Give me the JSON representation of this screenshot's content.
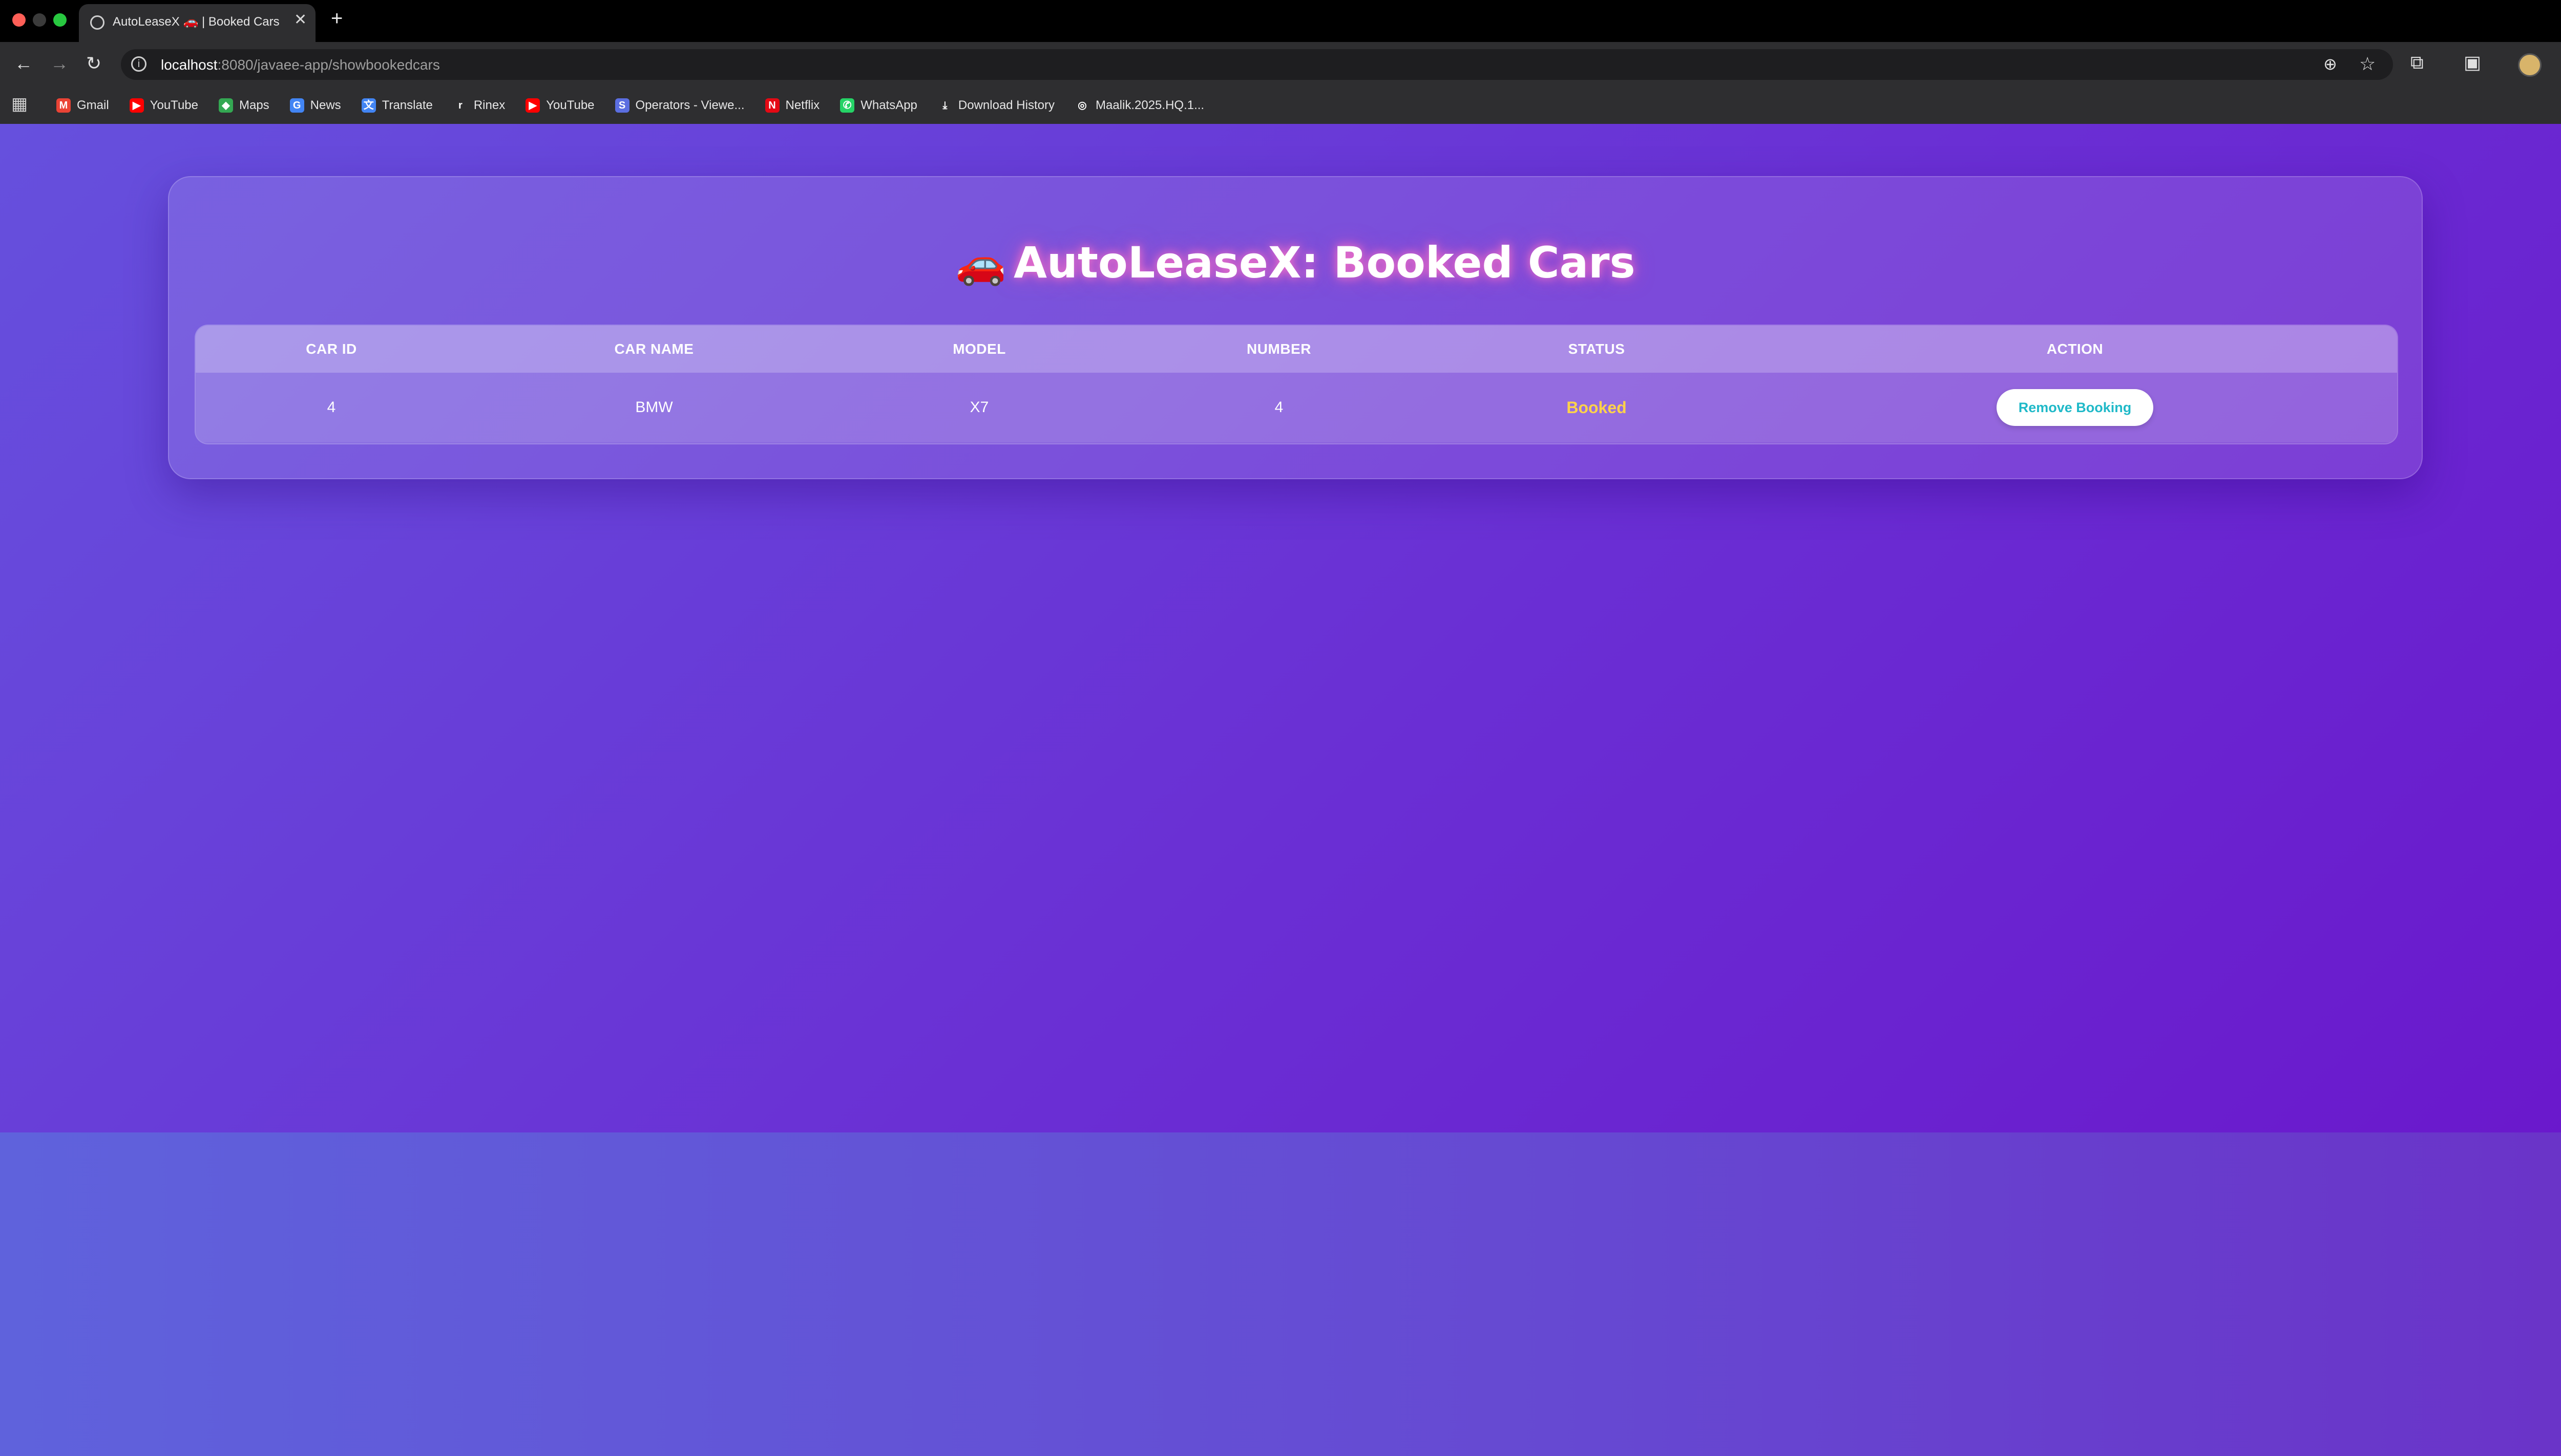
{
  "browser": {
    "tab_title": "AutoLeaseX 🚗 | Booked Cars",
    "url_host": "localhost",
    "url_path": ":8080/javaee-app/showbookedcars",
    "bookmarks": [
      {
        "label": "Gmail",
        "icon": "gmail-icon",
        "glyph": "M",
        "color": "#ea4335"
      },
      {
        "label": "YouTube",
        "icon": "youtube-icon",
        "glyph": "▶",
        "color": "#ff0000"
      },
      {
        "label": "Maps",
        "icon": "maps-icon",
        "glyph": "◆",
        "color": "#34a853"
      },
      {
        "label": "News",
        "icon": "news-icon",
        "glyph": "G",
        "color": "#4285f4"
      },
      {
        "label": "Translate",
        "icon": "translate-icon",
        "glyph": "文",
        "color": "#4285f4"
      },
      {
        "label": "Rinex",
        "icon": "rinex-icon",
        "glyph": "r",
        "color": "#2e2e30"
      },
      {
        "label": "YouTube",
        "icon": "youtube-icon",
        "glyph": "▶",
        "color": "#ff0000"
      },
      {
        "label": "Operators - Viewe...",
        "icon": "operators-icon",
        "glyph": "S",
        "color": "#5b6ee1"
      },
      {
        "label": "Netflix",
        "icon": "netflix-icon",
        "glyph": "N",
        "color": "#e50914"
      },
      {
        "label": "WhatsApp",
        "icon": "whatsapp-icon",
        "glyph": "✆",
        "color": "#25d366"
      },
      {
        "label": "Download History",
        "icon": "download-icon",
        "glyph": "⤓",
        "color": "#2e2e30"
      },
      {
        "label": "Maalik.2025.HQ.1...",
        "icon": "globe-icon",
        "glyph": "◎",
        "color": "#2e2e30"
      }
    ]
  },
  "page": {
    "title_emoji": "🚗",
    "title": "AutoLeaseX: Booked Cars"
  },
  "table": {
    "headers": [
      "CAR ID",
      "CAR NAME",
      "MODEL",
      "NUMBER",
      "STATUS",
      "ACTION"
    ],
    "rows": [
      {
        "car_id": "4",
        "car_name": "BMW",
        "model": "X7",
        "number": "4",
        "status": "Booked",
        "action": "Remove Booking"
      }
    ]
  },
  "colors": {
    "accent_status": "#ffd24a",
    "button_text": "#1fb9c8",
    "gradient_start": "#6650dd",
    "gradient_end": "#6a18cc"
  }
}
